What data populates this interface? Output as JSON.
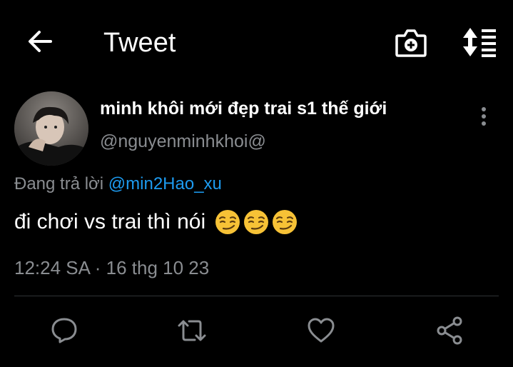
{
  "header": {
    "title": "Tweet",
    "back_icon": "arrow-left-icon",
    "camera_icon": "camera-add-icon",
    "sort_icon": "sort-list-icon"
  },
  "tweet": {
    "display_name": "minh khôi mới đẹp trai s1 thế giới",
    "handle": "@nguyenminhkhoi@",
    "reply_prefix": "Đang trả lời ",
    "reply_to": "@min2Hao_xu",
    "text": "đi chơi vs trai thì nói",
    "emojis": [
      "smirk-emoji",
      "smirk-emoji",
      "smirk-emoji"
    ],
    "timestamp": "12:24 SA · 16 thg 10 23"
  },
  "actions": {
    "reply_icon": "comment-icon",
    "retweet_icon": "retweet-icon",
    "like_icon": "heart-icon",
    "share_icon": "share-icon"
  },
  "colors": {
    "background": "#000000",
    "text": "#ffffff",
    "secondary": "#8a8d91",
    "link": "#1d9bf0",
    "divider": "#2f3336",
    "emoji": "#f7c236"
  }
}
